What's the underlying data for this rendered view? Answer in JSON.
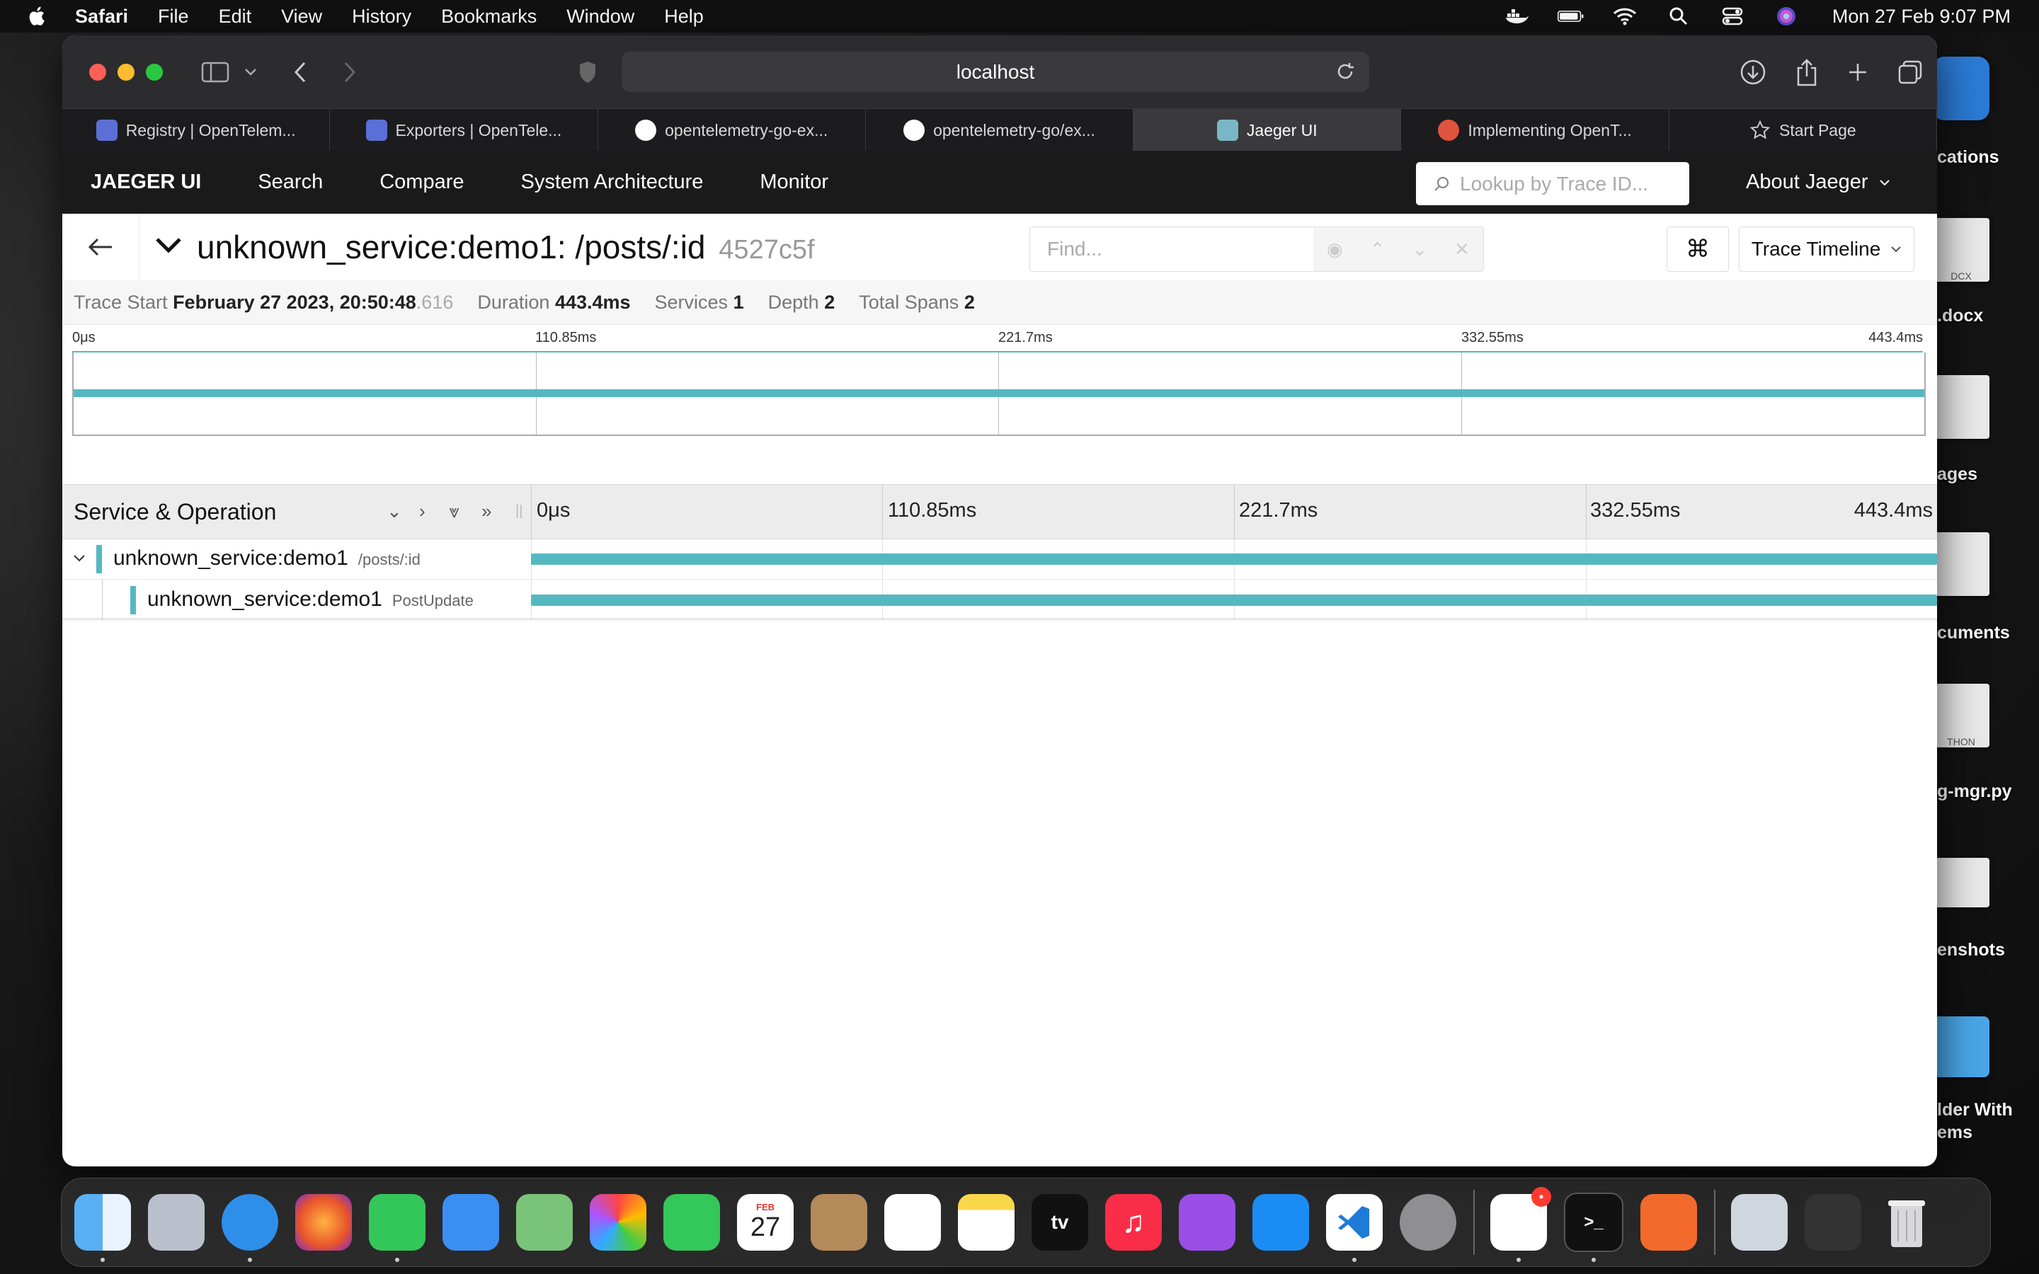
{
  "menubar": {
    "app": "Safari",
    "menus": [
      "File",
      "Edit",
      "View",
      "History",
      "Bookmarks",
      "Window",
      "Help"
    ],
    "clock": "Mon 27 Feb  9:07 PM"
  },
  "desktop": {
    "items": [
      "cations",
      ".docx",
      "ages",
      "cuments",
      "g-mgr.py",
      "enshots",
      "lder With",
      "ems"
    ],
    "file_tags": [
      "DCX",
      "THON"
    ]
  },
  "browser": {
    "url": "localhost",
    "tabs": [
      {
        "title": "Registry | OpenTelem...",
        "icon": "opentelemetry-icon"
      },
      {
        "title": "Exporters | OpenTele...",
        "icon": "opentelemetry-icon"
      },
      {
        "title": "opentelemetry-go-ex...",
        "icon": "github-icon"
      },
      {
        "title": "opentelemetry-go/ex...",
        "icon": "github-icon"
      },
      {
        "title": "Jaeger UI",
        "icon": "jaeger-icon",
        "active": true
      },
      {
        "title": "Implementing OpenT...",
        "icon": "eye-icon"
      },
      {
        "title": "Start Page",
        "icon": "star-icon"
      }
    ]
  },
  "jaeger": {
    "nav": {
      "brand": "JAEGER UI",
      "links": [
        "Search",
        "Compare",
        "System Architecture",
        "Monitor"
      ],
      "lookup_placeholder": "Lookup by Trace ID...",
      "about": "About Jaeger"
    },
    "trace": {
      "title": "unknown_service:demo1: /posts/:id",
      "trace_id": "4527c5f",
      "find_placeholder": "Find...",
      "view_mode": "Trace Timeline",
      "cmd_symbol": "⌘"
    },
    "summary": {
      "start_label": "Trace Start",
      "start_value": "February 27 2023, 20:50:48",
      "start_ms": ".616",
      "duration_label": "Duration",
      "duration_value": "443.4ms",
      "services_label": "Services",
      "services_value": "1",
      "depth_label": "Depth",
      "depth_value": "2",
      "spans_label": "Total Spans",
      "spans_value": "2"
    },
    "ticks": [
      "0μs",
      "110.85ms",
      "221.7ms",
      "332.55ms",
      "443.4ms"
    ],
    "timeline_header": "Service & Operation",
    "spans": [
      {
        "service": "unknown_service:demo1",
        "operation": "/posts/:id",
        "depth": 0,
        "start_fraction": 0,
        "duration_fraction": 1
      },
      {
        "service": "unknown_service:demo1",
        "operation": "PostUpdate",
        "depth": 1,
        "start_fraction": 0,
        "duration_fraction": 1
      }
    ]
  },
  "dock": {
    "apps": [
      "Finder",
      "Launchpad",
      "Safari",
      "Firefox",
      "Messages",
      "Mail",
      "Maps",
      "Photos",
      "FaceTime",
      "Calendar",
      "Contacts",
      "Reminders",
      "Notes",
      "TV",
      "Music",
      "Podcasts",
      "App Store",
      "Visual Studio Code",
      "System Settings",
      "Slack",
      "Terminal",
      "Pages"
    ],
    "calendar_month": "FEB",
    "calendar_day": "27",
    "tv_label": "tv",
    "colors": {
      "accent": "#55b8c0",
      "nav": "#1a1a1a"
    }
  }
}
